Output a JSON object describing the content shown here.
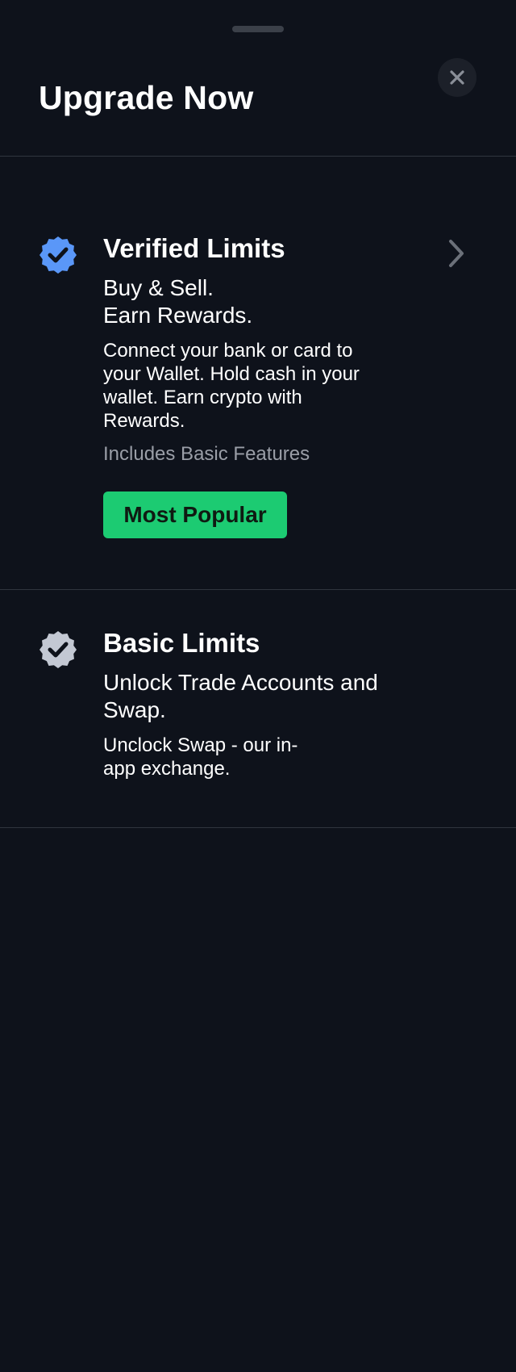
{
  "header": {
    "title": "Upgrade Now"
  },
  "tiers": {
    "verified": {
      "title": "Verified Limits",
      "tagline": "Buy & Sell.\nEarn Rewards.",
      "description": "Connect your bank or card to your Wallet. Hold cash in your wallet. Earn crypto with Rewards.",
      "includes": "Includes Basic Features",
      "badge_label": "Most Popular",
      "badge_color": "#5a97f8",
      "icon": "verified-badge-icon"
    },
    "basic": {
      "title": "Basic Limits",
      "tagline": "Unlock Trade Accounts and Swap.",
      "description": "Unclock Swap - our in-app exchange.",
      "badge_color": "#c3c8d3",
      "icon": "basic-badge-icon"
    }
  },
  "colors": {
    "background": "#0e121b",
    "accent_green": "#1ccb72",
    "divider": "#30353e"
  }
}
